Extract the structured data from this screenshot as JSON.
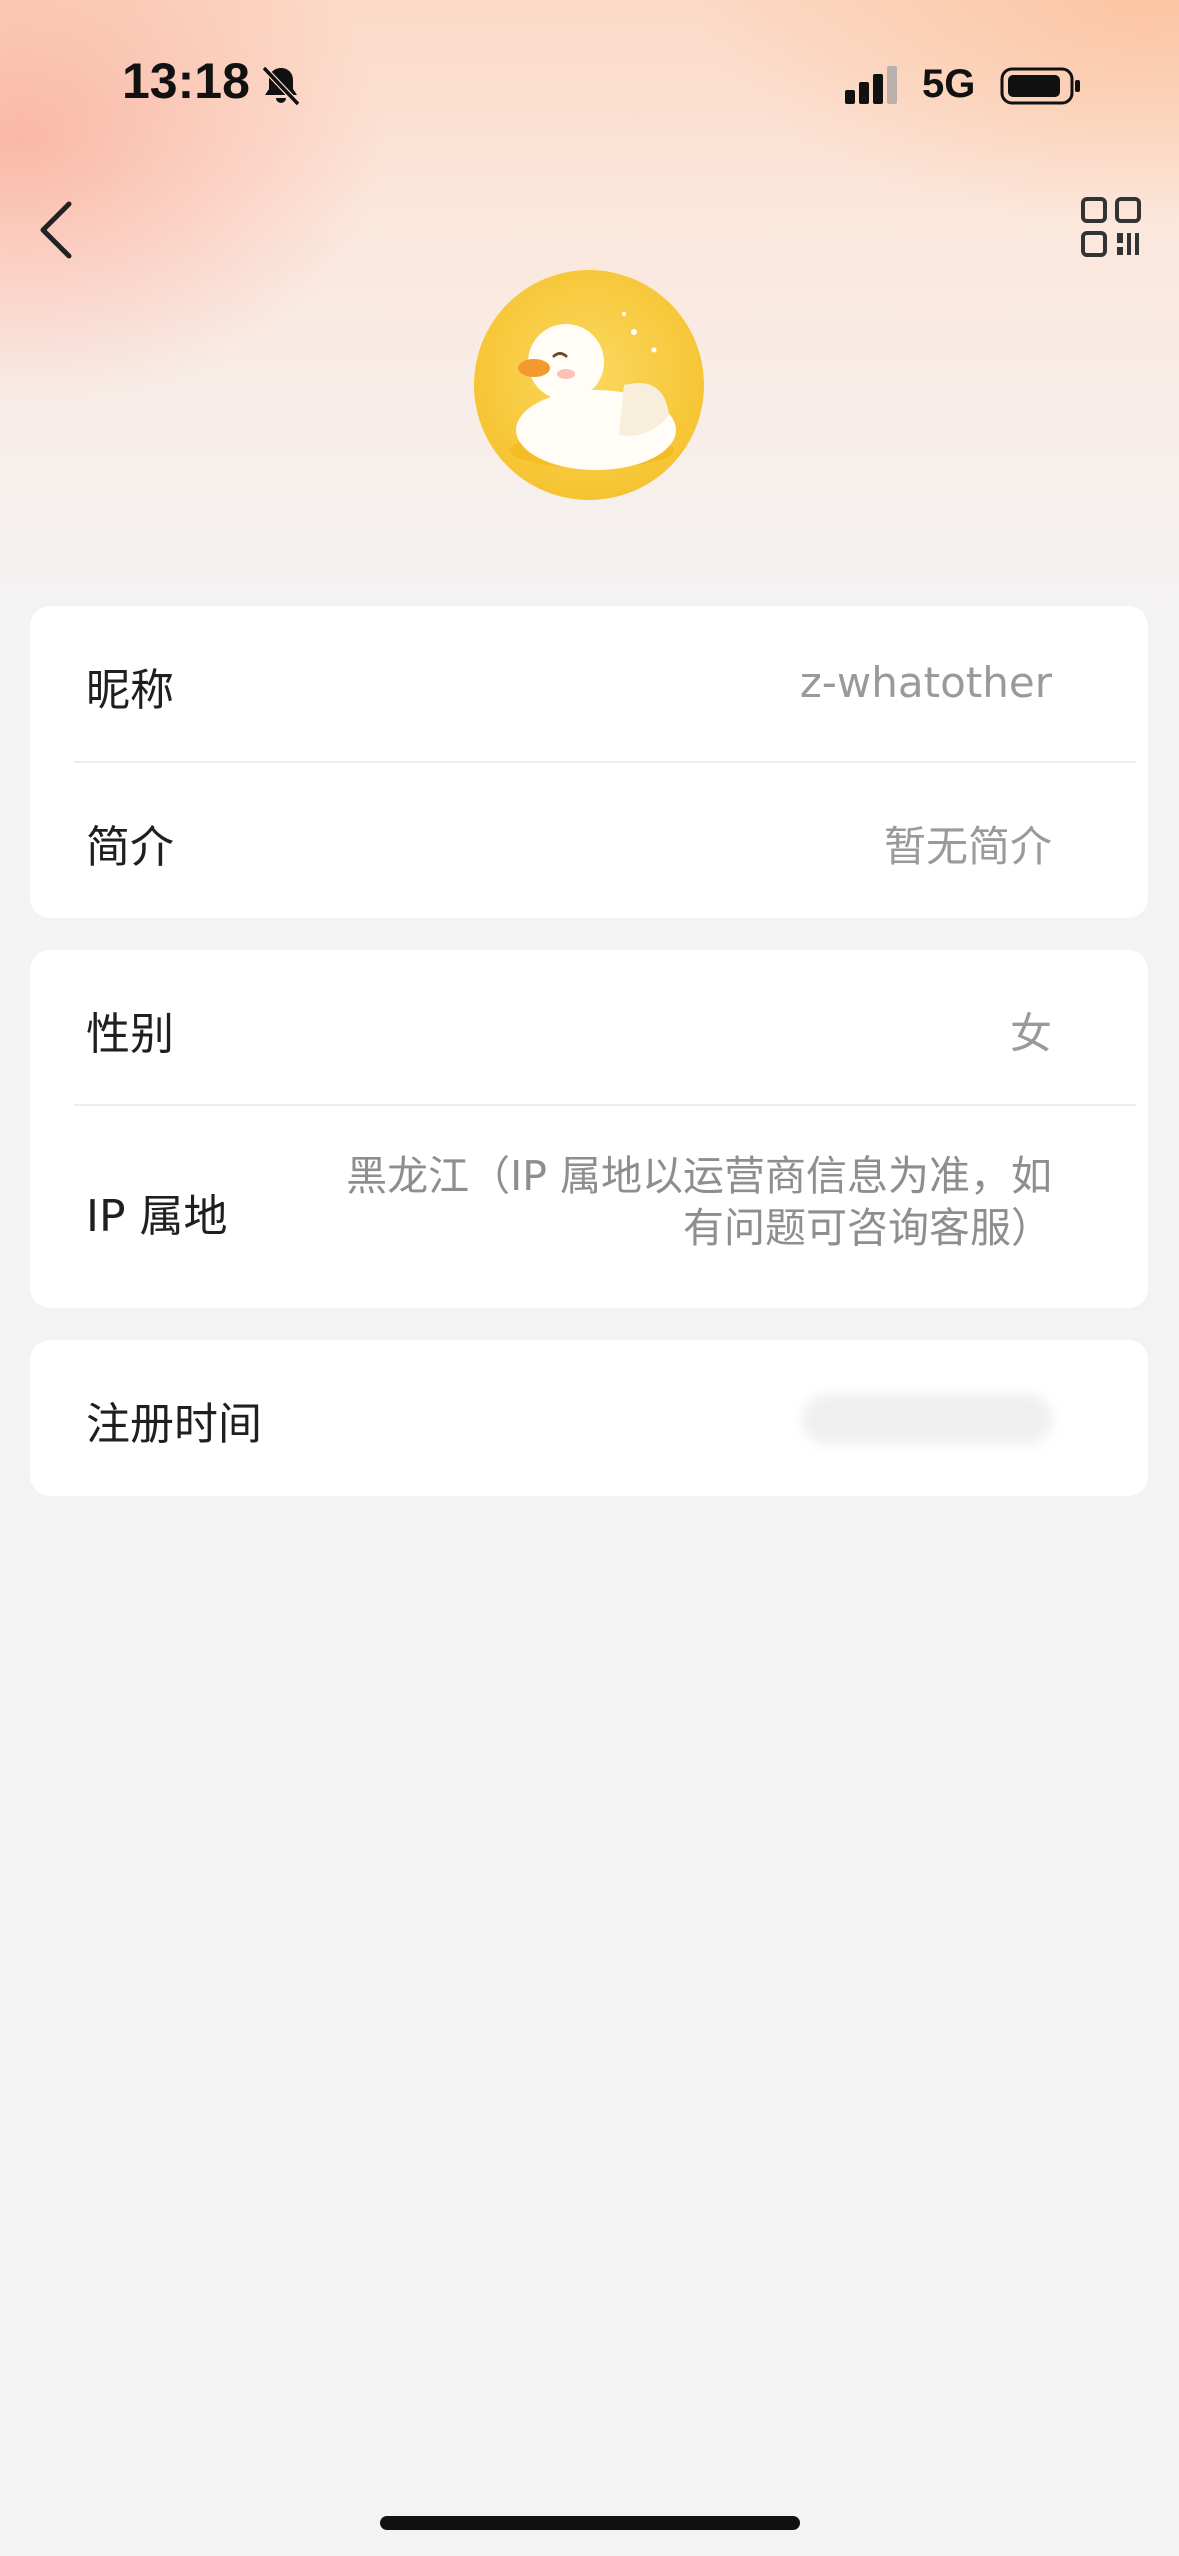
{
  "status_bar": {
    "time": "13:18",
    "network": "5G"
  },
  "nav": {
    "back_icon": "chevron-left-icon",
    "qr_icon": "qr-code-icon"
  },
  "avatar": {
    "description_icon": "duck-avatar"
  },
  "profile": {
    "nickname_label": "昵称",
    "nickname_value": "z-whatother",
    "bio_label": "简介",
    "bio_value": "暂无简介",
    "gender_label": "性别",
    "gender_value": "女",
    "ip_label": "IP 属地",
    "ip_value": "黑龙江（IP 属地以运营商信息为准，如有问题可咨询客服）",
    "register_label": "注册时间"
  }
}
